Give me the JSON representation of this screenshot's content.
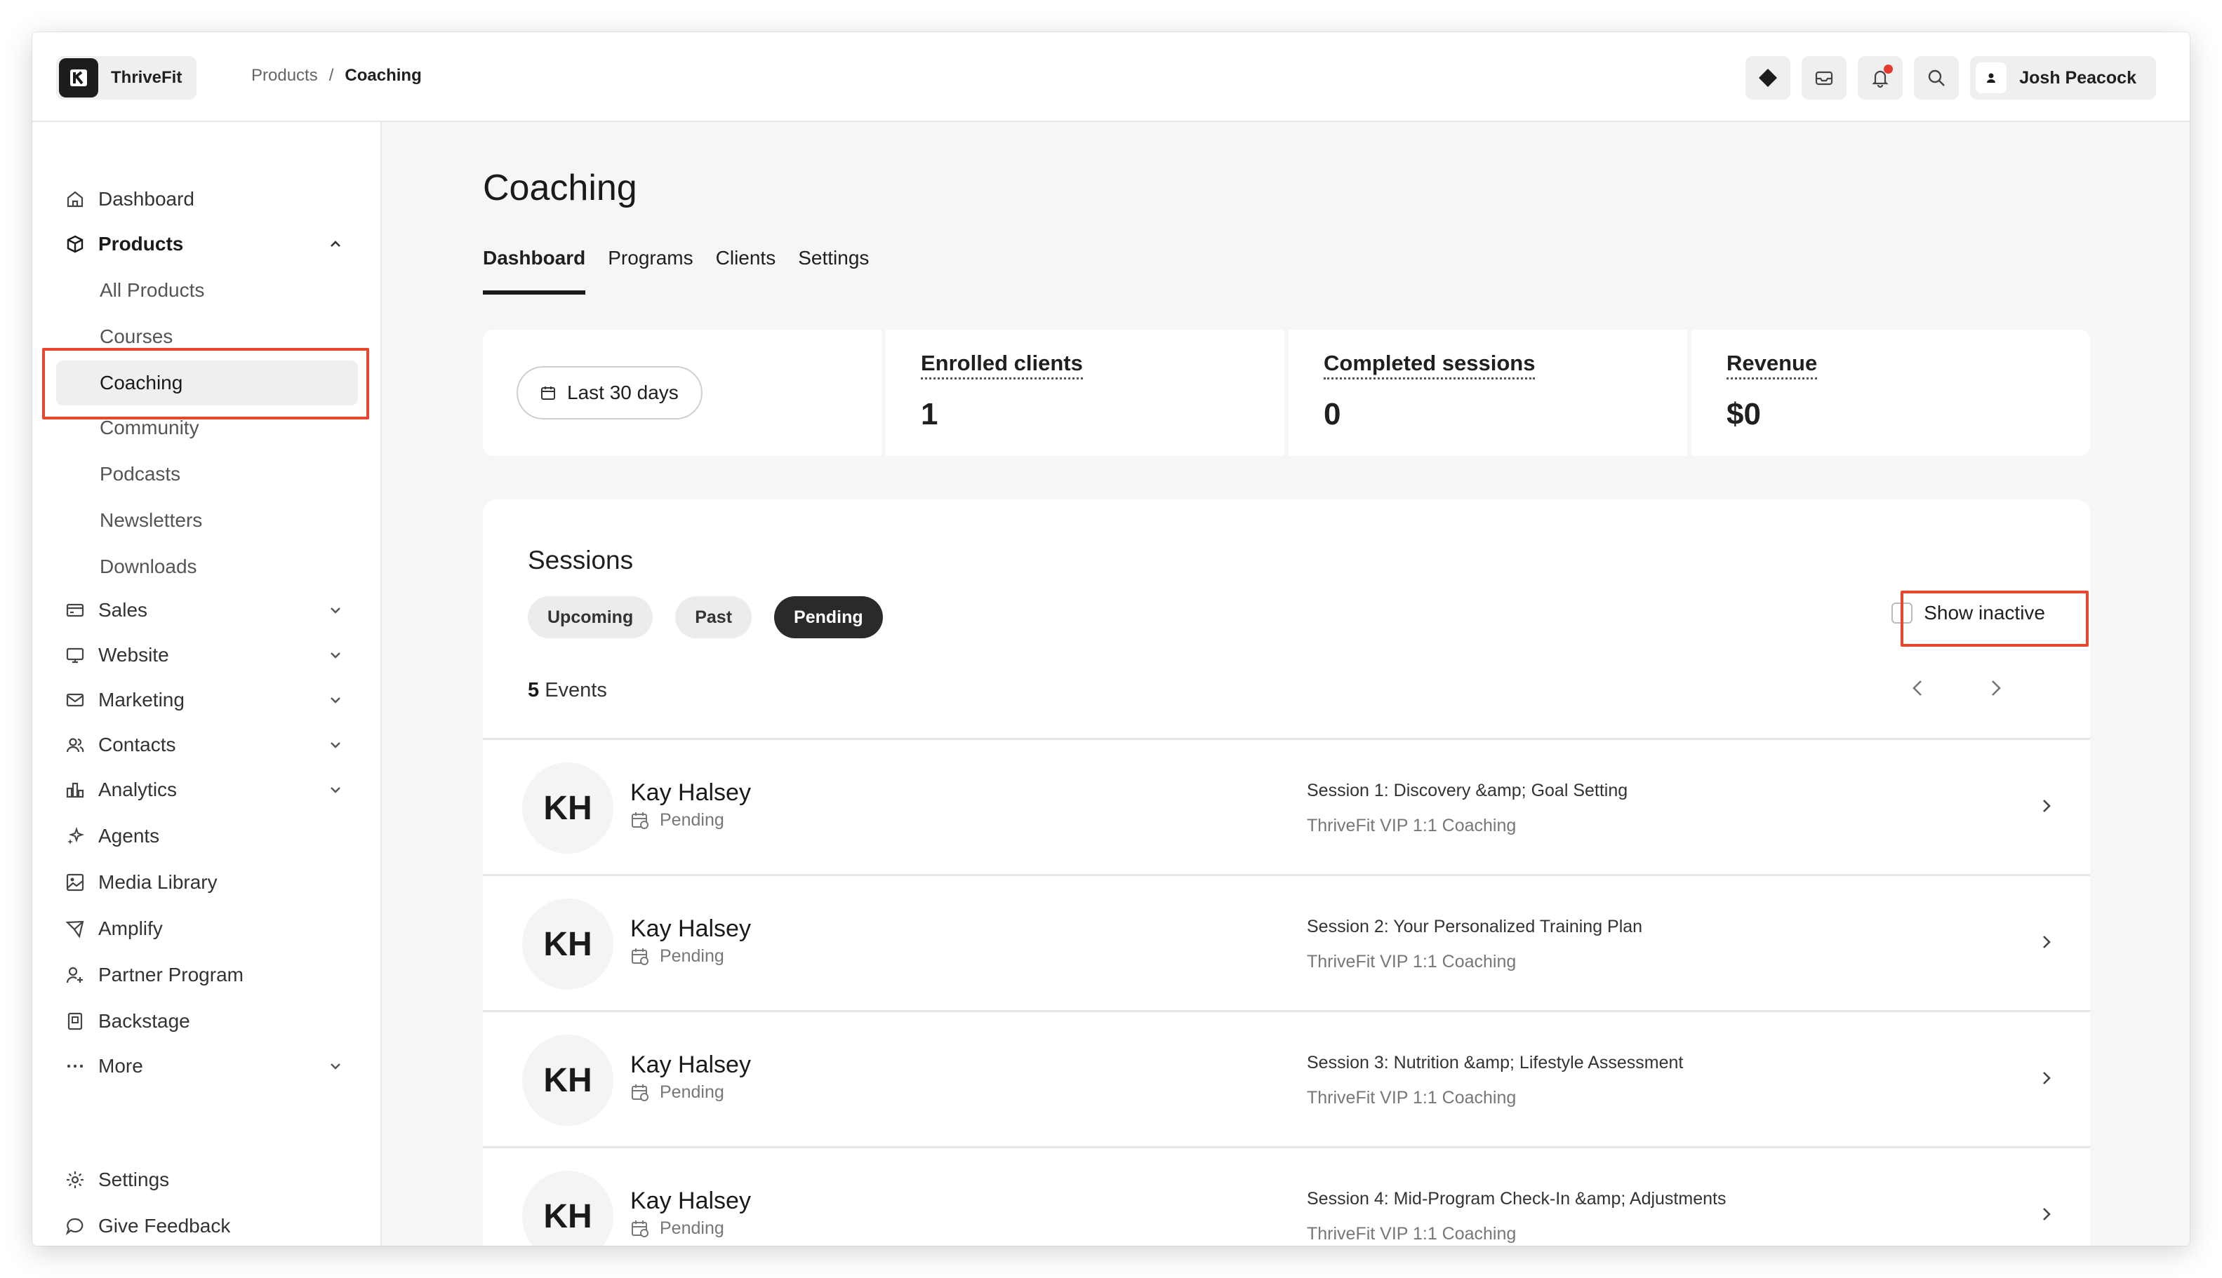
{
  "app": {
    "name": "ThriveFit"
  },
  "breadcrumb": {
    "parent": "Products",
    "separator": "/",
    "current": "Coaching"
  },
  "user": {
    "name": "Josh Peacock"
  },
  "header_icons": [
    "diamond-icon",
    "inbox-icon",
    "bell-icon",
    "search-icon"
  ],
  "sidebar": {
    "items": [
      {
        "label": "Dashboard",
        "icon": "home-icon"
      },
      {
        "label": "Products",
        "icon": "box-icon",
        "expanded": true
      },
      {
        "label": "Sales",
        "icon": "card-icon"
      },
      {
        "label": "Website",
        "icon": "monitor-icon"
      },
      {
        "label": "Marketing",
        "icon": "mail-icon"
      },
      {
        "label": "Contacts",
        "icon": "users-icon"
      },
      {
        "label": "Analytics",
        "icon": "chart-icon"
      },
      {
        "label": "Agents",
        "icon": "sparkle-icon"
      },
      {
        "label": "Media Library",
        "icon": "image-icon"
      },
      {
        "label": "Amplify",
        "icon": "send-icon"
      },
      {
        "label": "Partner Program",
        "icon": "partner-icon"
      },
      {
        "label": "Backstage",
        "icon": "backstage-icon"
      },
      {
        "label": "More",
        "icon": "dots-icon"
      }
    ],
    "products_sub": [
      "All Products",
      "Courses",
      "Coaching",
      "Community",
      "Podcasts",
      "Newsletters",
      "Downloads"
    ],
    "active_sub": "Coaching",
    "footer": [
      {
        "label": "Settings",
        "icon": "gear-icon"
      },
      {
        "label": "Give Feedback",
        "icon": "chat-icon"
      }
    ]
  },
  "page": {
    "title": "Coaching",
    "tabs": [
      "Dashboard",
      "Programs",
      "Clients",
      "Settings"
    ],
    "active_tab": "Dashboard"
  },
  "stats": {
    "date_range": "Last 30 days",
    "cards": [
      {
        "label": "Enrolled clients",
        "value": "1"
      },
      {
        "label": "Completed sessions",
        "value": "0"
      },
      {
        "label": "Revenue",
        "value": "$0"
      }
    ]
  },
  "sessions": {
    "title": "Sessions",
    "filters": [
      "Upcoming",
      "Past",
      "Pending"
    ],
    "active_filter": "Pending",
    "show_inactive_label": "Show inactive",
    "events_count": "5",
    "events_label": "Events",
    "rows": [
      {
        "initials": "KH",
        "name": "Kay Halsey",
        "status": "Pending",
        "session": "Session 1: Discovery &amp; Goal Setting",
        "program": "ThriveFit VIP 1:1 Coaching"
      },
      {
        "initials": "KH",
        "name": "Kay Halsey",
        "status": "Pending",
        "session": "Session 2: Your Personalized Training Plan",
        "program": "ThriveFit VIP 1:1 Coaching"
      },
      {
        "initials": "KH",
        "name": "Kay Halsey",
        "status": "Pending",
        "session": "Session 3: Nutrition &amp; Lifestyle Assessment",
        "program": "ThriveFit VIP 1:1 Coaching"
      },
      {
        "initials": "KH",
        "name": "Kay Halsey",
        "status": "Pending",
        "session": "Session 4: Mid-Program Check-In &amp; Adjustments",
        "program": "ThriveFit VIP 1:1 Coaching"
      }
    ]
  },
  "colors": {
    "highlight": "#e8472f",
    "notification": "#e33b2e",
    "active_pill": "#2a2a2a"
  }
}
